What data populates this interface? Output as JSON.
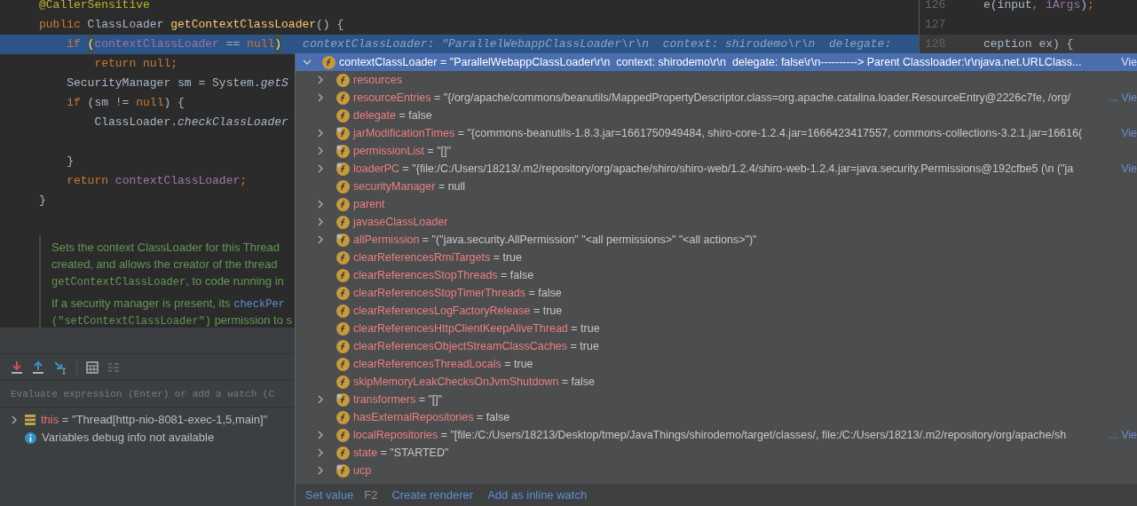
{
  "editor": {
    "lines": [
      {
        "current": false,
        "tokens": [
          {
            "kind": "annotation",
            "t": "@CallerSensitive"
          }
        ]
      },
      {
        "current": false,
        "tokens": [
          {
            "kind": "keyword",
            "t": "public"
          },
          {
            "kind": "plain",
            "t": " ClassLoader "
          },
          {
            "kind": "method",
            "t": "getContextClassLoader"
          },
          {
            "kind": "plain",
            "t": "() {"
          }
        ]
      },
      {
        "current": true,
        "tokens": [
          {
            "kind": "keyword",
            "t": "    if "
          },
          {
            "kind": "paren",
            "t": "("
          },
          {
            "kind": "field",
            "t": "contextClassLoader"
          },
          {
            "kind": "plain",
            "t": " == "
          },
          {
            "kind": "keyword",
            "t": "null"
          },
          {
            "kind": "paren",
            "t": ")"
          }
        ]
      },
      {
        "current": false,
        "tokens": [
          {
            "kind": "keyword",
            "t": "        return null;"
          }
        ]
      },
      {
        "current": false,
        "tokens": [
          {
            "kind": "plain",
            "t": "    SecurityManager sm = System."
          },
          {
            "kind": "italic",
            "t": "getS"
          }
        ]
      },
      {
        "current": false,
        "tokens": [
          {
            "kind": "keyword",
            "t": "    if"
          },
          {
            "kind": "plain",
            "t": " (sm != "
          },
          {
            "kind": "keyword",
            "t": "null"
          },
          {
            "kind": "plain",
            "t": ") {"
          }
        ]
      },
      {
        "current": false,
        "tokens": [
          {
            "kind": "plain",
            "t": "        ClassLoader."
          },
          {
            "kind": "italic",
            "t": "checkClassLoader"
          }
        ]
      },
      {
        "current": false
      },
      {
        "current": false,
        "tokens": [
          {
            "kind": "plain",
            "t": "    }"
          }
        ]
      },
      {
        "current": false,
        "tokens": [
          {
            "kind": "keyword",
            "t": "    return "
          },
          {
            "kind": "field",
            "t": "contextClassLoader"
          },
          {
            "kind": "keyword",
            "t": ";"
          }
        ]
      },
      {
        "current": false,
        "tokens": [
          {
            "kind": "plain",
            "t": "}"
          }
        ]
      }
    ]
  },
  "inline_hint": "contextClassLoader: \"ParallelWebappClassLoader\\r\\n  context: shirodemo\\r\\n  delegate: ",
  "doc_comment": {
    "paragraphs": [
      [
        [
          {
            "kind": "text",
            "t": "Sets the context ClassLoader for this Thread"
          }
        ],
        [
          {
            "kind": "text",
            "t": "created, and allows the creator of the thread"
          }
        ],
        [
          {
            "kind": "code",
            "t": "getContextClassLoader"
          },
          {
            "kind": "text",
            "t": ", to code running in"
          }
        ]
      ],
      [
        [
          {
            "kind": "text",
            "t": "If a security manager is present, its "
          },
          {
            "kind": "link",
            "t": "checkPer"
          }
        ],
        [
          {
            "kind": "code",
            "t": "(\"setContextClassLoader\")"
          },
          {
            "kind": "text",
            "t": " permission to s"
          }
        ]
      ]
    ]
  },
  "side_editor": {
    "lines": [
      {
        "number": "126",
        "current": false,
        "tokens": [
          {
            "kind": "plain",
            "t": "e(input"
          },
          {
            "kind": "keyword",
            "t": ", "
          },
          {
            "kind": "field",
            "t": "iArgs"
          },
          {
            "kind": "plain",
            "t": ")"
          },
          {
            "kind": "keyword",
            "t": ";"
          }
        ]
      },
      {
        "number": "127",
        "current": false
      },
      {
        "number": "128",
        "current": true,
        "tokens": [
          {
            "kind": "plain",
            "t": "ception ex) {"
          }
        ]
      }
    ]
  },
  "debugger": {
    "toolbar": [
      {
        "kind": "step-into"
      },
      {
        "kind": "step-out"
      },
      {
        "kind": "run-to-cursor"
      },
      {
        "kind": "separator"
      },
      {
        "kind": "evaluate"
      },
      {
        "kind": "trace"
      }
    ],
    "evaluate_placeholder": "Evaluate expression (Enter) or add a watch (C",
    "variables": [
      {
        "kind": "object",
        "name": "this",
        "value": " = \"Thread[http-nio-8081-exec-1,5,main]\"",
        "expandable": true
      },
      {
        "kind": "info",
        "name": "Variables debug info not available",
        "expandable": false
      }
    ]
  },
  "popup": {
    "header": {
      "name": "contextClassLoader",
      "value": " = \"ParallelWebappClassLoader\\r\\n  context: shirodemo\\r\\n  delegate: false\\r\\n----------> Parent Classloader:\\r\\njava.net.URLClass...",
      "view": "Vie",
      "expanded": true,
      "selected": true
    },
    "rows": [
      {
        "name": "resources",
        "expandable": true,
        "marked": false
      },
      {
        "name": "resourceEntries",
        "value": " = \"{/org/apache/commons/beanutils/MappedPropertyDescriptor.class=org.apache.catalina.loader.ResourceEntry@2226c7fe, /org/",
        "view": "... Vie",
        "expandable": true,
        "marked": false
      },
      {
        "name": "delegate",
        "value": " = false",
        "expandable": false,
        "marked": false
      },
      {
        "name": "jarModificationTimes",
        "value": " = \"{commons-beanutils-1.8.3.jar=1661750949484, shiro-core-1.2.4.jar=1666423417557, commons-collections-3.2.1.jar=16616(",
        "view": "Vie",
        "expandable": true,
        "marked": true
      },
      {
        "name": "permissionList",
        "value": " = \"[]\"",
        "expandable": true,
        "marked": true
      },
      {
        "name": "loaderPC",
        "value": " = \"{file:/C:/Users/18213/.m2/repository/org/apache/shiro/shiro-web/1.2.4/shiro-web-1.2.4.jar=java.security.Permissions@192cfbe5 (\\n (\"ja",
        "view": "Vie",
        "expandable": true,
        "marked": true
      },
      {
        "name": "securityManager",
        "value": " = null",
        "expandable": false,
        "marked": false
      },
      {
        "name": "parent",
        "expandable": true,
        "marked": false
      },
      {
        "name": "javaseClassLoader",
        "expandable": true,
        "marked": false
      },
      {
        "name": "allPermission",
        "value": " = \"(\"java.security.AllPermission\" \"<all permissions>\" \"<all actions>\")\"",
        "expandable": true,
        "marked": true
      },
      {
        "name": "clearReferencesRmiTargets",
        "value": " = true",
        "expandable": false,
        "marked": false
      },
      {
        "name": "clearReferencesStopThreads",
        "value": " = false",
        "expandable": false,
        "marked": false
      },
      {
        "name": "clearReferencesStopTimerThreads",
        "value": " = false",
        "expandable": false,
        "marked": false
      },
      {
        "name": "clearReferencesLogFactoryRelease",
        "value": " = true",
        "expandable": false,
        "marked": false
      },
      {
        "name": "clearReferencesHttpClientKeepAliveThread",
        "value": " = true",
        "expandable": false,
        "marked": false
      },
      {
        "name": "clearReferencesObjectStreamClassCaches",
        "value": " = true",
        "expandable": false,
        "marked": false
      },
      {
        "name": "clearReferencesThreadLocals",
        "value": " = true",
        "expandable": false,
        "marked": false
      },
      {
        "name": "skipMemoryLeakChecksOnJvmShutdown",
        "value": " = false",
        "expandable": false,
        "marked": false
      },
      {
        "name": "transformers",
        "value": " = \"[]\"",
        "expandable": true,
        "marked": true
      },
      {
        "name": "hasExternalRepositories",
        "value": " = false",
        "expandable": false,
        "marked": false
      },
      {
        "name": "localRepositories",
        "value": " = \"[file:/C:/Users/18213/Desktop/tmep/JavaThings/shirodemo/target/classes/, file:/C:/Users/18213/.m2/repository/org/apache/sh",
        "view": "... Vie",
        "expandable": true,
        "marked": false
      },
      {
        "name": "state",
        "value": " = \"STARTED\"",
        "expandable": true,
        "marked": false
      },
      {
        "name": "ucp",
        "expandable": true,
        "marked": true
      }
    ],
    "actions": [
      {
        "label": "Set value",
        "shortcut": "F2"
      },
      {
        "label": "Create renderer"
      },
      {
        "label": "Add as inline watch"
      }
    ]
  }
}
